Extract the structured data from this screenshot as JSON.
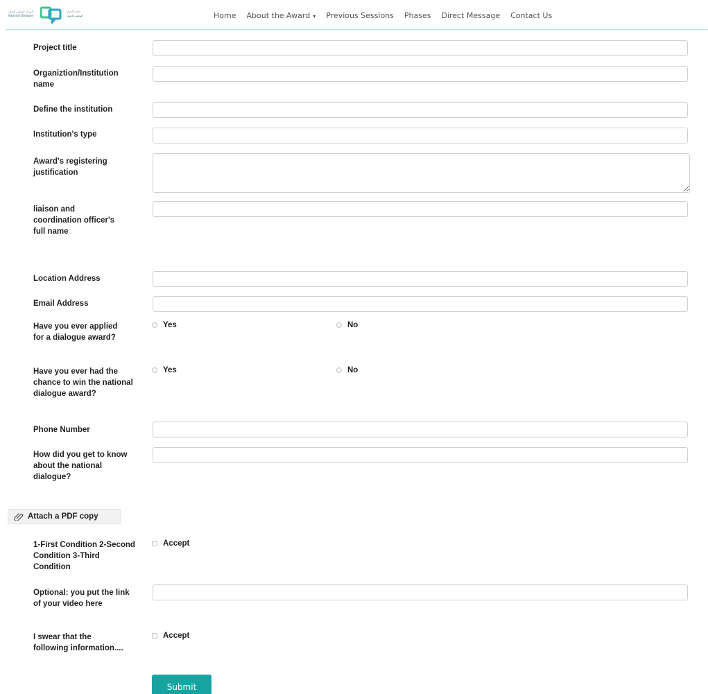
{
  "nav": {
    "logo_text_left_1": "المركز الوطني للحوار",
    "logo_text_left_2": "National Dialogue",
    "logo_text_right_1": "جائزة الحوار",
    "logo_text_right_2": "الوطني للحوار",
    "items": [
      "Home",
      "About the Award",
      "Previous Sessions",
      "Phases",
      "Direct Message",
      "Contact Us"
    ]
  },
  "form": {
    "project_title": "Project title",
    "org_name": "Organiztion/Institution name",
    "define_institution": "Define the institution",
    "institution_type": "Institution's type",
    "justification": "Award's registering justification",
    "liaison": "liaison and coordination officer's full name",
    "location": "Location Address",
    "email": "Email Address",
    "applied_q": "Have you ever applied for a dialogue award?",
    "won_q": "Have you ever had the chance to win the national dialogue award?",
    "yes": "Yes",
    "no": "No",
    "phone": "Phone Number",
    "how_know": "How did you get to know about the national dialogue?",
    "attach": "Attach a PDF copy",
    "conditions": "1-First Condition 2-Second Condition 3-Third Condition",
    "accept": "Accept",
    "video": "Optional: you put the link of your video here",
    "swear": "I swear that the following information....",
    "submit": "Submit"
  }
}
